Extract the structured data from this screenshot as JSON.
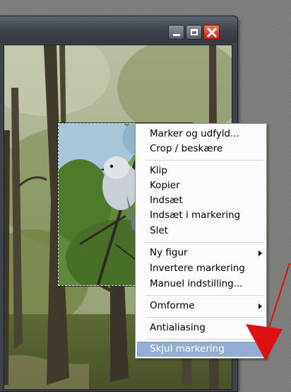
{
  "window": {
    "buttons": {
      "minimize_icon": "minimize-icon",
      "maximize_icon": "maximize-icon",
      "close_icon": "close-icon"
    }
  },
  "context_menu": {
    "groups": [
      [
        "Marker og udfyld...",
        "Crop / beskære"
      ],
      [
        "Klip",
        "Kopier",
        "Indsæt",
        "Indsæt i markering",
        "Slet"
      ],
      [
        "Ny figur",
        "Invertere markering",
        "Manuel indstilling..."
      ],
      [
        "Omforme"
      ],
      [
        "Antialiasing"
      ],
      [
        "Skjul markering"
      ]
    ],
    "items": {
      "marker_og_udfyld": "Marker og udfyld...",
      "crop": "Crop / beskære",
      "klip": "Klip",
      "kopier": "Kopier",
      "indsaet": "Indsæt",
      "indsaet_i_markering": "Indsæt i markering",
      "slet": "Slet",
      "ny_figur": "Ny figur",
      "invertere_markering": "Invertere markering",
      "manuel_indstilling": "Manuel indstilling...",
      "omforme": "Omforme",
      "antialiasing": "Antialiasing",
      "skjul_markering": "Skjul markering"
    },
    "submenu_items": [
      "Ny figur",
      "Omforme"
    ],
    "highlighted_item": "Skjul markering"
  },
  "colors": {
    "menu_highlight": "#93aed4",
    "close_button": "#c42510",
    "annotation_arrow": "#e01010",
    "desktop": "#7d7d7b"
  }
}
